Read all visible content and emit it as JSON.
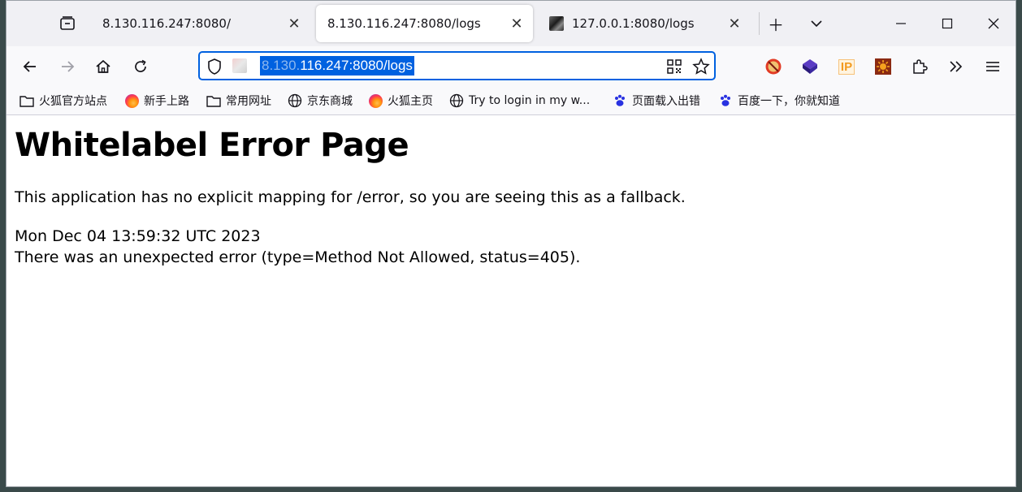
{
  "tabs": [
    {
      "title": "8.130.116.247:8080/",
      "active": false
    },
    {
      "title": "8.130.116.247:8080/logs",
      "active": true
    },
    {
      "title": "127.0.0.1:8080/logs",
      "active": false
    }
  ],
  "tab_strip_icons": [
    "tab-manager-icon",
    "new-tab-icon",
    "tab-list-chevron-icon",
    "minimize-icon",
    "maximize-icon",
    "close-icon"
  ],
  "navigation": {
    "icons": [
      "back-arrow-icon",
      "forward-arrow-icon",
      "home-icon",
      "reload-icon"
    ],
    "url_blurred": "8.130.",
    "url_visible": "116.247:8080/logs",
    "url_icons": [
      "shield-icon",
      "qr-code-icon",
      "star-bookmark-icon"
    ],
    "toolbar_icons": [
      "adblock-extension-icon",
      "cube-extension-icon",
      "ip-extension-icon",
      "sun-extension-icon",
      "extensions-puzzle-icon",
      "overflow-chevrons-icon",
      "hamburger-menu-icon"
    ],
    "ip_badge": "IP"
  },
  "bookmarks": [
    {
      "label": "火狐官方站点",
      "icon": "folder-icon"
    },
    {
      "label": "新手上路",
      "icon": "firefox-icon"
    },
    {
      "label": "常用网址",
      "icon": "folder-icon"
    },
    {
      "label": "京东商城",
      "icon": "globe-icon"
    },
    {
      "label": "火狐主页",
      "icon": "firefox-icon"
    },
    {
      "label": "Try to login in my w...",
      "icon": "globe-icon"
    },
    {
      "label": "页面载入出错",
      "icon": "baidu-paw-icon"
    },
    {
      "label": "百度一下，你就知道",
      "icon": "baidu-paw-icon"
    }
  ],
  "page": {
    "heading": "Whitelabel Error Page",
    "message": "This application has no explicit mapping for /error, so you are seeing this as a fallback.",
    "timestamp": "Mon Dec 04 13:59:32 UTC 2023",
    "error_detail": "There was an unexpected error (type=Method Not Allowed, status=405)."
  },
  "colors": {
    "accent": "#0061e0",
    "tabstrip_bg": "#f0f0f4",
    "toolbar_bg": "#f9f9fb"
  }
}
